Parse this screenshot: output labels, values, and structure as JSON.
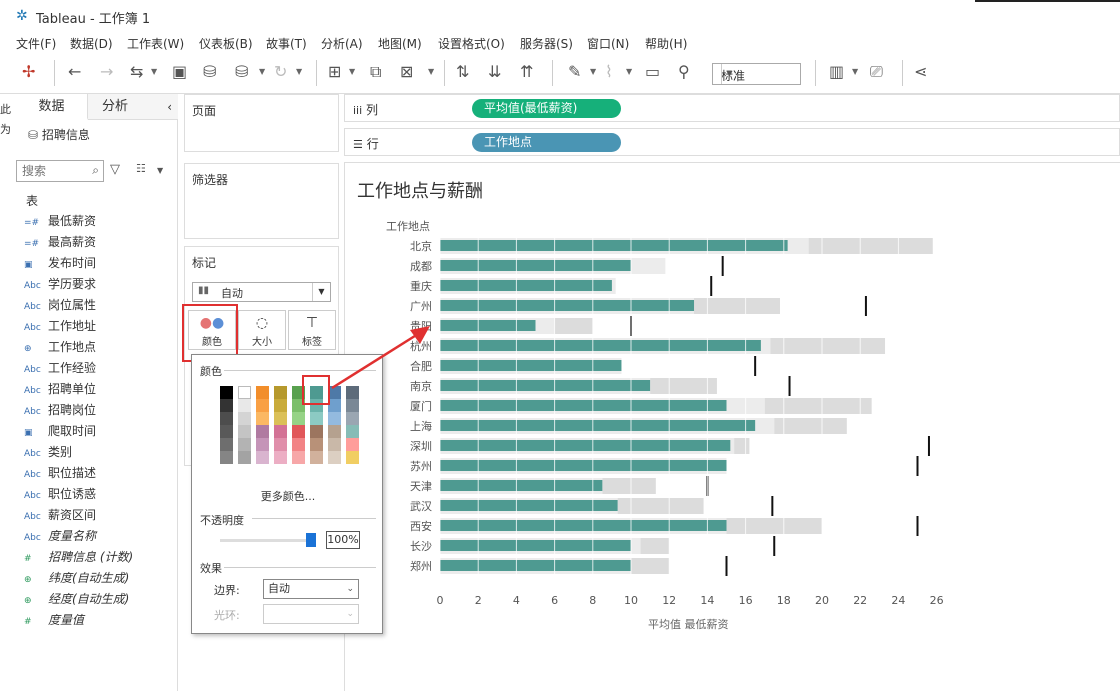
{
  "window": {
    "title": "Tableau - 工作簿 1"
  },
  "menu": [
    "文件(F)",
    "数据(D)",
    "工作表(W)",
    "仪表板(B)",
    "故事(T)",
    "分析(A)",
    "地图(M)",
    "设置格式(O)",
    "服务器(S)",
    "窗口(N)",
    "帮助(H)"
  ],
  "toolbar": {
    "fit_select": "标准"
  },
  "left_pane": {
    "tabs": [
      "数据",
      "分析"
    ],
    "datasource": "招聘信息",
    "search_placeholder": "搜索",
    "table_header": "表",
    "cutoff_text": "此\n为",
    "fields": [
      {
        "icon": "=#",
        "label": "最低薪资",
        "italic": false
      },
      {
        "icon": "=#",
        "label": "最高薪资",
        "italic": false
      },
      {
        "icon": "cal",
        "label": "发布时间",
        "italic": false
      },
      {
        "icon": "Abc",
        "label": "学历要求",
        "italic": false
      },
      {
        "icon": "Abc",
        "label": "岗位属性",
        "italic": false
      },
      {
        "icon": "Abc",
        "label": "工作地址",
        "italic": false
      },
      {
        "icon": "globe",
        "label": "工作地点",
        "italic": false
      },
      {
        "icon": "Abc",
        "label": "工作经验",
        "italic": false
      },
      {
        "icon": "Abc",
        "label": "招聘单位",
        "italic": false
      },
      {
        "icon": "Abc",
        "label": "招聘岗位",
        "italic": false
      },
      {
        "icon": "cal",
        "label": "爬取时间",
        "italic": false
      },
      {
        "icon": "Abc",
        "label": "类别",
        "italic": false
      },
      {
        "icon": "Abc",
        "label": "职位描述",
        "italic": false
      },
      {
        "icon": "Abc",
        "label": "职位诱惑",
        "italic": false
      },
      {
        "icon": "Abc",
        "label": "薪资区间",
        "italic": false
      },
      {
        "icon": "Abc",
        "label": "度量名称",
        "italic": true
      },
      {
        "icon": "#",
        "label": "招聘信息 (计数)",
        "italic": true
      },
      {
        "icon": "globe",
        "label": "纬度(自动生成)",
        "italic": true
      },
      {
        "icon": "globe",
        "label": "经度(自动生成)",
        "italic": true
      },
      {
        "icon": "#",
        "label": "度量值",
        "italic": true
      }
    ]
  },
  "cards": {
    "pages": "页面",
    "filters": "筛选器",
    "marks": "标记",
    "mark_type": "自动",
    "mark_buttons": [
      "颜色",
      "大小",
      "标签"
    ]
  },
  "shelves": {
    "columns_label": "列",
    "columns_pill": "平均值(最低薪资)",
    "rows_label": "行",
    "rows_pill": "工作地点"
  },
  "popup": {
    "color_title": "颜色",
    "more_colors": "更多颜色...",
    "opacity_title": "不透明度",
    "opacity_value": "100%",
    "opacity_fraction": 1.0,
    "effects_title": "效果",
    "border_label": "边界:",
    "border_value": "自动",
    "halo_label": "光环:",
    "halo_value": ""
  },
  "colors": {
    "bar": "#4e9a91",
    "rows_pill": "#4a95b4",
    "columns_pill": "#16b07a",
    "highlight": "#e03030",
    "slider": "#1a72d6"
  },
  "chart_data": {
    "type": "bar",
    "title": "工作地点与薪酬",
    "row_header": "工作地点",
    "xlabel": "平均值 最低薪资",
    "xlim": [
      0,
      26
    ],
    "xticks": [
      0,
      2,
      4,
      6,
      8,
      10,
      12,
      14,
      16,
      18,
      20,
      22,
      24,
      26
    ],
    "categories": [
      "北京",
      "成都",
      "重庆",
      "广州",
      "贵阳",
      "杭州",
      "合肥",
      "南京",
      "厦门",
      "上海",
      "深圳",
      "苏州",
      "天津",
      "武汉",
      "西安",
      "长沙",
      "郑州"
    ],
    "values": [
      18.2,
      10.0,
      9.0,
      13.3,
      5.0,
      16.8,
      9.5,
      11.0,
      15.0,
      16.5,
      15.2,
      15.0,
      8.5,
      9.3,
      15.0,
      10.0,
      10.0
    ],
    "reference_lines": [
      null,
      14.8,
      14.2,
      22.3,
      10.0,
      null,
      16.5,
      18.3,
      null,
      null,
      25.6,
      25.0,
      14.0,
      17.4,
      25.0,
      17.5,
      15.0
    ],
    "bands": [
      [
        19.3,
        25.8
      ],
      [
        11.8,
        11.8
      ],
      [
        9.2,
        9.2
      ],
      [
        13.3,
        17.8
      ],
      [
        6.0,
        8.0
      ],
      [
        17.3,
        23.3
      ],
      [
        9.5,
        9.5
      ],
      [
        11.0,
        14.5
      ],
      [
        17.0,
        22.6
      ],
      [
        17.5,
        21.3
      ],
      [
        15.4,
        16.2
      ],
      [
        15.0,
        15.0
      ],
      [
        8.5,
        11.3
      ],
      [
        9.3,
        13.8
      ],
      [
        15.0,
        20.0
      ],
      [
        10.5,
        12.0
      ],
      [
        10.0,
        12.0
      ]
    ]
  }
}
